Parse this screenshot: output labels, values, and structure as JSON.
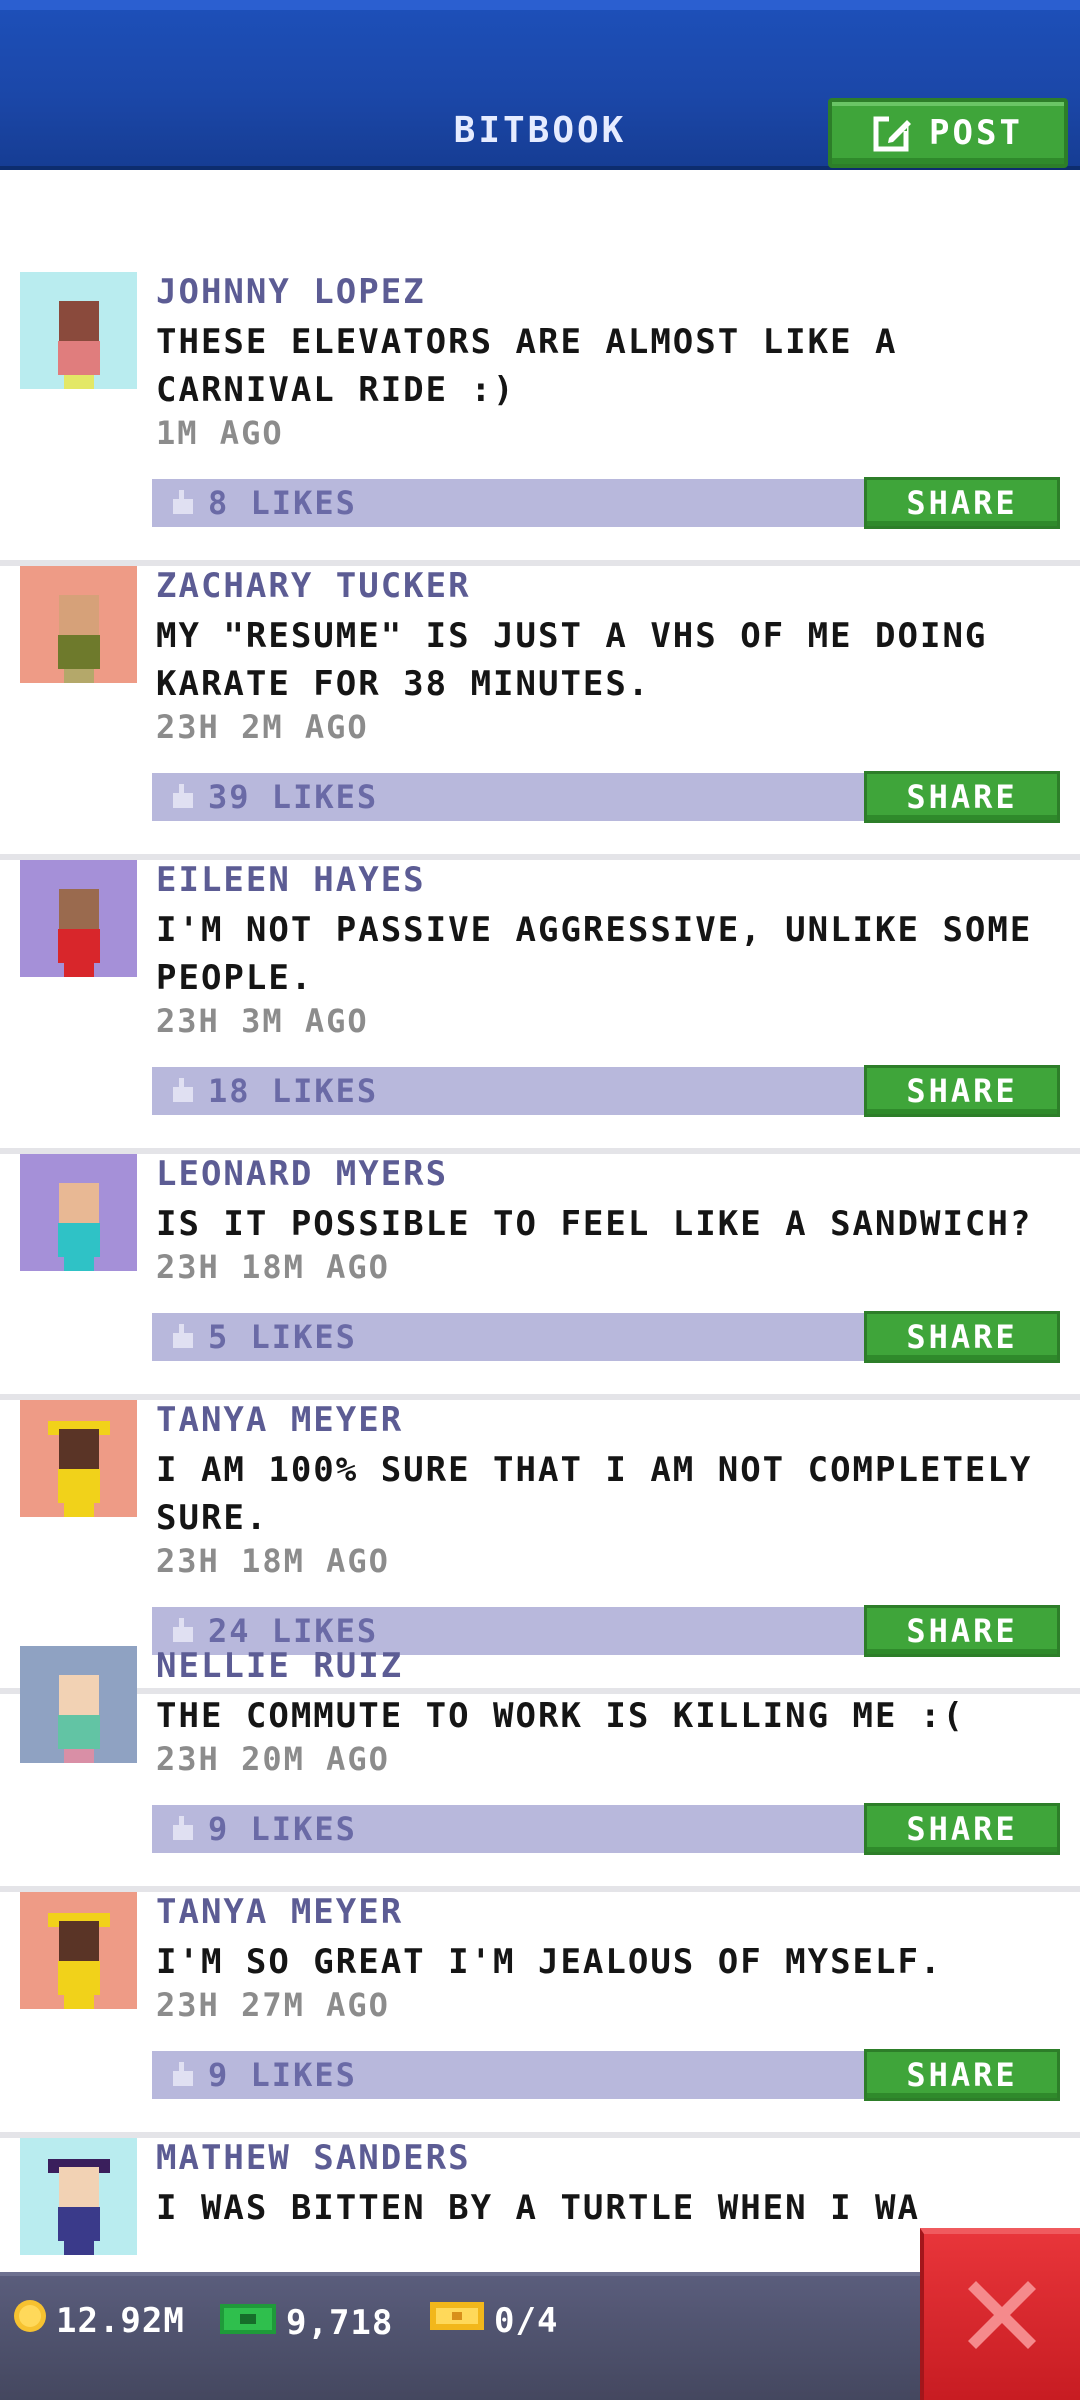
{
  "header": {
    "title": "BITBOOK",
    "post_label": "POST"
  },
  "posts": [
    {
      "author": "JOHNNY LOPEZ",
      "text": "THESE ELEVATORS ARE ALMOST LIKE A CARNIVAL RIDE :)",
      "time": "1M AGO",
      "likes": "8 LIKES",
      "share": "SHARE",
      "bg": "#b9ecef",
      "skin": "#8a4a3c",
      "shirt": "#e07d7d",
      "legs": "#e3e866"
    },
    {
      "author": "ZACHARY TUCKER",
      "text": "MY \"RESUME\" IS JUST A VHS OF ME DOING KARATE FOR 38 MINUTES.",
      "time": "23H 2M AGO",
      "likes": "39 LIKES",
      "share": "SHARE",
      "bg": "#ee9b86",
      "skin": "#d6a179",
      "shirt": "#6e7a2c",
      "legs": "#b4a86a"
    },
    {
      "author": "EILEEN HAYES",
      "text": "I'M NOT PASSIVE AGGRESSIVE, UNLIKE SOME PEOPLE.",
      "time": "23H 3M AGO",
      "likes": "18 LIKES",
      "share": "SHARE",
      "bg": "#a590d8",
      "skin": "#9a6a4e",
      "shirt": "#d8262b",
      "legs": "#d8262b"
    },
    {
      "author": "LEONARD MYERS",
      "text": "IS IT POSSIBLE TO FEEL LIKE A SANDWICH?",
      "time": "23H 18M AGO",
      "likes": "5 LIKES",
      "share": "SHARE",
      "bg": "#a590d8",
      "skin": "#e8b894",
      "shirt": "#2fc2c6",
      "legs": "#2fc2c6"
    },
    {
      "author": "TANYA MEYER",
      "text": "I AM 100% SURE THAT I AM NOT COMPLETELY SURE.",
      "time": "23H 18M AGO",
      "likes": "24 LIKES",
      "share": "SHARE",
      "bg": "#ee9b86",
      "skin": "#5a3426",
      "shirt": "#f1d21a",
      "legs": "#f1d21a"
    },
    {
      "author": "NELLIE RUIZ",
      "text": "THE COMMUTE TO WORK IS KILLING ME :(",
      "time": "23H 20M AGO",
      "likes": "9 LIKES",
      "share": "SHARE",
      "bg": "#8fa2c2",
      "skin": "#f2d2b4",
      "shirt": "#62c4a4",
      "legs": "#d98fa6"
    },
    {
      "author": "TANYA MEYER",
      "text": "I'M SO GREAT I'M JEALOUS OF MYSELF.",
      "time": "23H 27M AGO",
      "likes": "9 LIKES",
      "share": "SHARE",
      "bg": "#ee9b86",
      "skin": "#5a3426",
      "shirt": "#f1d21a",
      "legs": "#f1d21a"
    },
    {
      "author": "MATHEW SANDERS",
      "text": "I WAS BITTEN BY A TURTLE WHEN I WA",
      "time": "",
      "likes": "",
      "share": "",
      "bg": "#b9ecef",
      "skin": "#f2d2b4",
      "shirt": "#3a3a8a",
      "legs": "#3a3a8a"
    }
  ],
  "footer": {
    "coins": "12.92M",
    "bux": "9,718",
    "tickets": "0/4"
  }
}
